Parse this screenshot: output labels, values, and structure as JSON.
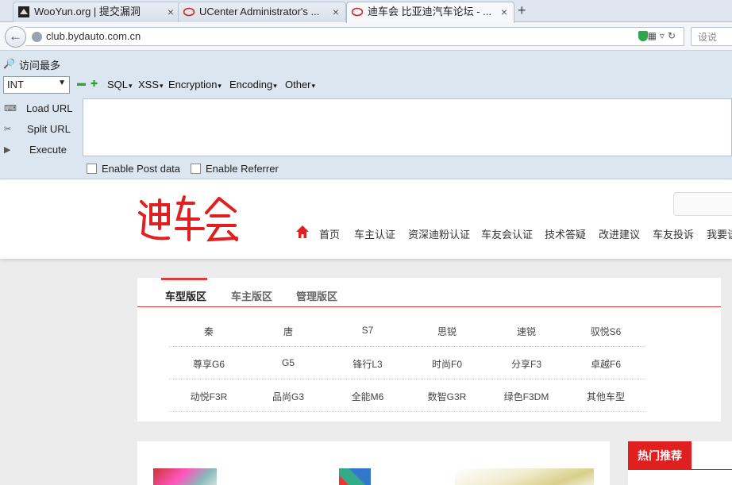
{
  "browser": {
    "tabs": [
      {
        "title": "WooYun.org | 提交漏洞",
        "active": false
      },
      {
        "title": "UCenter Administrator's ...",
        "active": false
      },
      {
        "title": "迪车会 比亚迪汽车论坛 - ...",
        "active": true
      }
    ],
    "new_tab": "+",
    "url": "club.bydauto.com.cn",
    "search_placeholder": "设说"
  },
  "bookmarks": {
    "most_visited": "访问最多"
  },
  "hackbar": {
    "type_select": "INT",
    "menus": [
      "SQL",
      "XSS",
      "Encryption",
      "Encoding",
      "Other"
    ],
    "load_url": "Load URL",
    "split_url": "Split URL",
    "execute": "Execute",
    "url_value": "",
    "enable_post": "Enable Post data",
    "enable_referrer": "Enable Referrer"
  },
  "site": {
    "logo_text": "迪车会",
    "accent_color": "#e02020",
    "nav": [
      "首页",
      "车主认证",
      "资深迪粉认证",
      "车友会认证",
      "技术答疑",
      "改进建议",
      "车友投诉",
      "我要该"
    ]
  },
  "forum_panel": {
    "tabs": [
      "车型版区",
      "车主版区",
      "管理版区"
    ],
    "rows": [
      [
        "秦",
        "唐",
        "S7",
        "思锐",
        "速锐",
        "驭悦S6"
      ],
      [
        "尊享G6",
        "G5",
        "锋行L3",
        "时尚F0",
        "分享F3",
        "卓越F6"
      ],
      [
        "动悦F3R",
        "品尚G3",
        "全能M6",
        "数智G3R",
        "绿色F3DM",
        "其他车型"
      ]
    ]
  },
  "hot": {
    "title": "热门推荐"
  }
}
